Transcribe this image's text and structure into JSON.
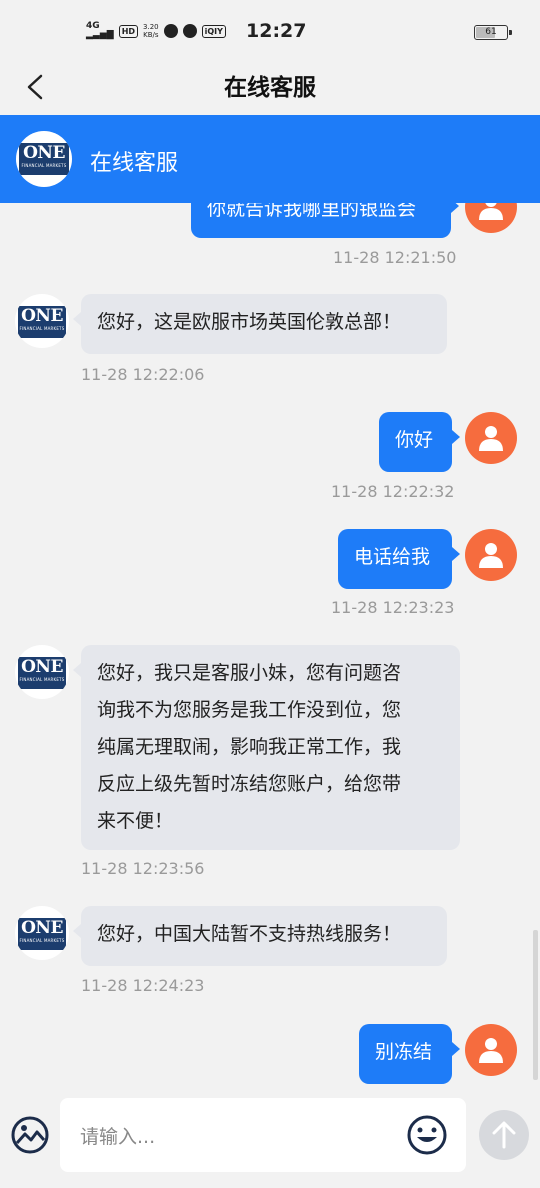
{
  "status_bar": {
    "network": "4G",
    "hd_badge": "HD",
    "speed_value": "3.20",
    "speed_unit": "KB/s",
    "iq_badge": "iQIY",
    "time": "12:27",
    "battery": "61"
  },
  "nav": {
    "title": "在线客服",
    "back_icon": "chevron-left-icon"
  },
  "chat_header": {
    "title": "在线客服",
    "logo_text": "ONE",
    "logo_subtext": "FINANCIAL MARKETS"
  },
  "messages": [
    {
      "sender": "user",
      "text": "你就告诉我哪里的银监会",
      "time": "11-28 12:21:50"
    },
    {
      "sender": "agent",
      "text": "您好，这是欧服市场英国伦敦总部！",
      "time": "11-28 12:22:06"
    },
    {
      "sender": "user",
      "text": "你好",
      "time": "11-28 12:22:32"
    },
    {
      "sender": "user",
      "text": "电话给我",
      "time": "11-28 12:23:23"
    },
    {
      "sender": "agent",
      "lines": [
        "您好，我只是客服小妹，您有问题咨",
        "询我不为您服务是我工作没到位，您",
        "纯属无理取闹，影响我正常工作，我",
        "反应上级先暂时冻结您账户，给您带",
        "来不便！"
      ],
      "time": "11-28 12:23:56"
    },
    {
      "sender": "agent",
      "text": "您好，中国大陆暂不支持热线服务！",
      "time": "11-28 12:24:23"
    },
    {
      "sender": "user",
      "text": "别冻结",
      "time": ""
    }
  ],
  "input": {
    "placeholder": "请输入...",
    "gallery_icon": "image-icon",
    "emoji_icon": "smiley-icon",
    "send_icon": "arrow-up-icon"
  },
  "colors": {
    "brand_blue": "#1e7cf8",
    "user_avatar": "#f66c3e",
    "agent_bubble": "#e5e7ec",
    "logo_navy": "#1c3d6e"
  }
}
